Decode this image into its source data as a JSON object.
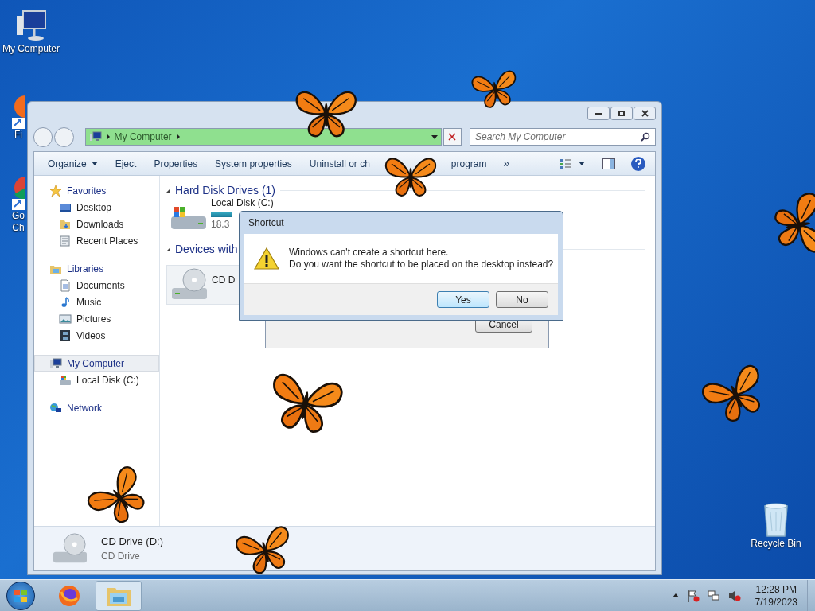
{
  "desktop_icons": [
    {
      "kind": "computer",
      "lines": [
        "My Computer"
      ]
    },
    {
      "kind": "firefox",
      "lines": [
        "Fi"
      ]
    },
    {
      "kind": "chrome",
      "lines": [
        "Go",
        "Ch"
      ]
    },
    {
      "kind": "recycle",
      "lines": [
        "Recycle Bin"
      ]
    }
  ],
  "explorer": {
    "address": {
      "crumbs": [
        "My Computer"
      ]
    },
    "search": {
      "placeholder": "Search My Computer"
    },
    "toolbar": [
      {
        "kind": "menu",
        "parts": [
          "Organize"
        ]
      },
      {
        "kind": "plain",
        "parts": [
          "Eject"
        ]
      },
      {
        "kind": "plain",
        "parts": [
          "Properties"
        ]
      },
      {
        "kind": "plain",
        "parts": [
          "System properties"
        ]
      },
      {
        "kind": "plain",
        "parts": [
          "Uninstall or ch",
          "program"
        ]
      },
      {
        "kind": "more",
        "parts": [
          "»"
        ]
      }
    ],
    "sidebar": [
      {
        "kind": "star",
        "label": "Favorites",
        "selected": false,
        "children": [
          {
            "kind": "desktop",
            "label": "Desktop",
            "selected": false
          },
          {
            "kind": "downloads",
            "label": "Downloads",
            "selected": false
          },
          {
            "kind": "recent",
            "label": "Recent Places",
            "selected": false
          }
        ]
      },
      {
        "kind": "libraries",
        "label": "Libraries",
        "selected": false,
        "children": [
          {
            "kind": "documents",
            "label": "Documents",
            "selected": false
          },
          {
            "kind": "music",
            "label": "Music",
            "selected": false
          },
          {
            "kind": "pictures",
            "label": "Pictures",
            "selected": false
          },
          {
            "kind": "videos",
            "label": "Videos",
            "selected": false
          }
        ]
      },
      {
        "kind": "computer",
        "label": "My Computer",
        "selected": true,
        "children": [
          {
            "kind": "disk",
            "label": "Local Disk (C:)",
            "selected": false
          }
        ]
      },
      {
        "kind": "network",
        "label": "Network",
        "selected": false
      }
    ],
    "groups": [
      {
        "title": "Hard Disk Drives (1)",
        "expanded": true,
        "items": [
          {
            "kind": "disk",
            "name": "Local Disk (C:)",
            "info": "18.3"
          }
        ]
      },
      {
        "title": "Devices with",
        "expanded": true,
        "items": [
          {
            "kind": "cd",
            "name": "CD D"
          }
        ]
      }
    ],
    "details": {
      "name": "CD Drive (D:)",
      "type": "CD Drive"
    }
  },
  "back_dialog": {
    "button": "Cancel"
  },
  "dialog": {
    "title": "Shortcut",
    "message": [
      "Windows can't create a shortcut here.",
      "Do you want the shortcut to be placed on the desktop instead?"
    ],
    "buttons": [
      {
        "label": "Yes",
        "selected": true
      },
      {
        "label": "No",
        "selected": false
      }
    ]
  },
  "taskbar": {
    "apps": [
      {
        "kind": "firefox",
        "selected": false
      },
      {
        "kind": "explorer",
        "selected": true
      }
    ],
    "time": "12:28 PM",
    "date": "7/19/2023"
  }
}
